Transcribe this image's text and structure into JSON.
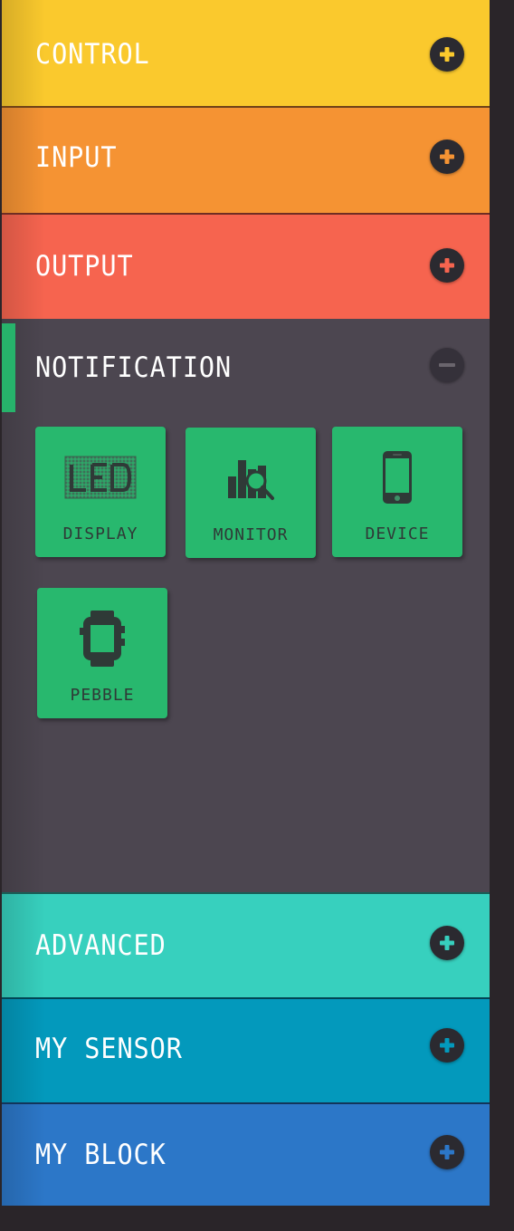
{
  "categories": {
    "control": {
      "label": "CONTROL",
      "state": "collapsed",
      "color": "#fac92d",
      "icon": "plus-icon"
    },
    "input": {
      "label": "INPUT",
      "state": "collapsed",
      "color": "#f59333",
      "icon": "plus-icon"
    },
    "output": {
      "label": "OUTPUT",
      "state": "collapsed",
      "color": "#f6644f",
      "icon": "plus-icon"
    },
    "notification": {
      "label": "NOTIFICATION",
      "state": "expanded",
      "color": "#4c4650",
      "accent": "#27b36b",
      "icon": "minus-icon",
      "blocks": [
        {
          "label": "DISPLAY",
          "icon": "lcd-display-icon"
        },
        {
          "label": "MONITOR",
          "icon": "monitor-chart-icon"
        },
        {
          "label": "DEVICE",
          "icon": "smartphone-icon"
        },
        {
          "label": "PEBBLE",
          "icon": "smartwatch-icon"
        }
      ]
    },
    "advanced": {
      "label": "ADVANCED",
      "state": "collapsed",
      "color": "#37d0be",
      "icon": "plus-icon"
    },
    "my_sensor": {
      "label": "MY SENSOR",
      "state": "collapsed",
      "color": "#0399bc",
      "icon": "plus-icon"
    },
    "my_block": {
      "label": "MY BLOCK",
      "state": "collapsed",
      "color": "#2c77c8",
      "icon": "plus-icon"
    }
  },
  "tile_color": "#28b86e",
  "background": "#2a2529"
}
